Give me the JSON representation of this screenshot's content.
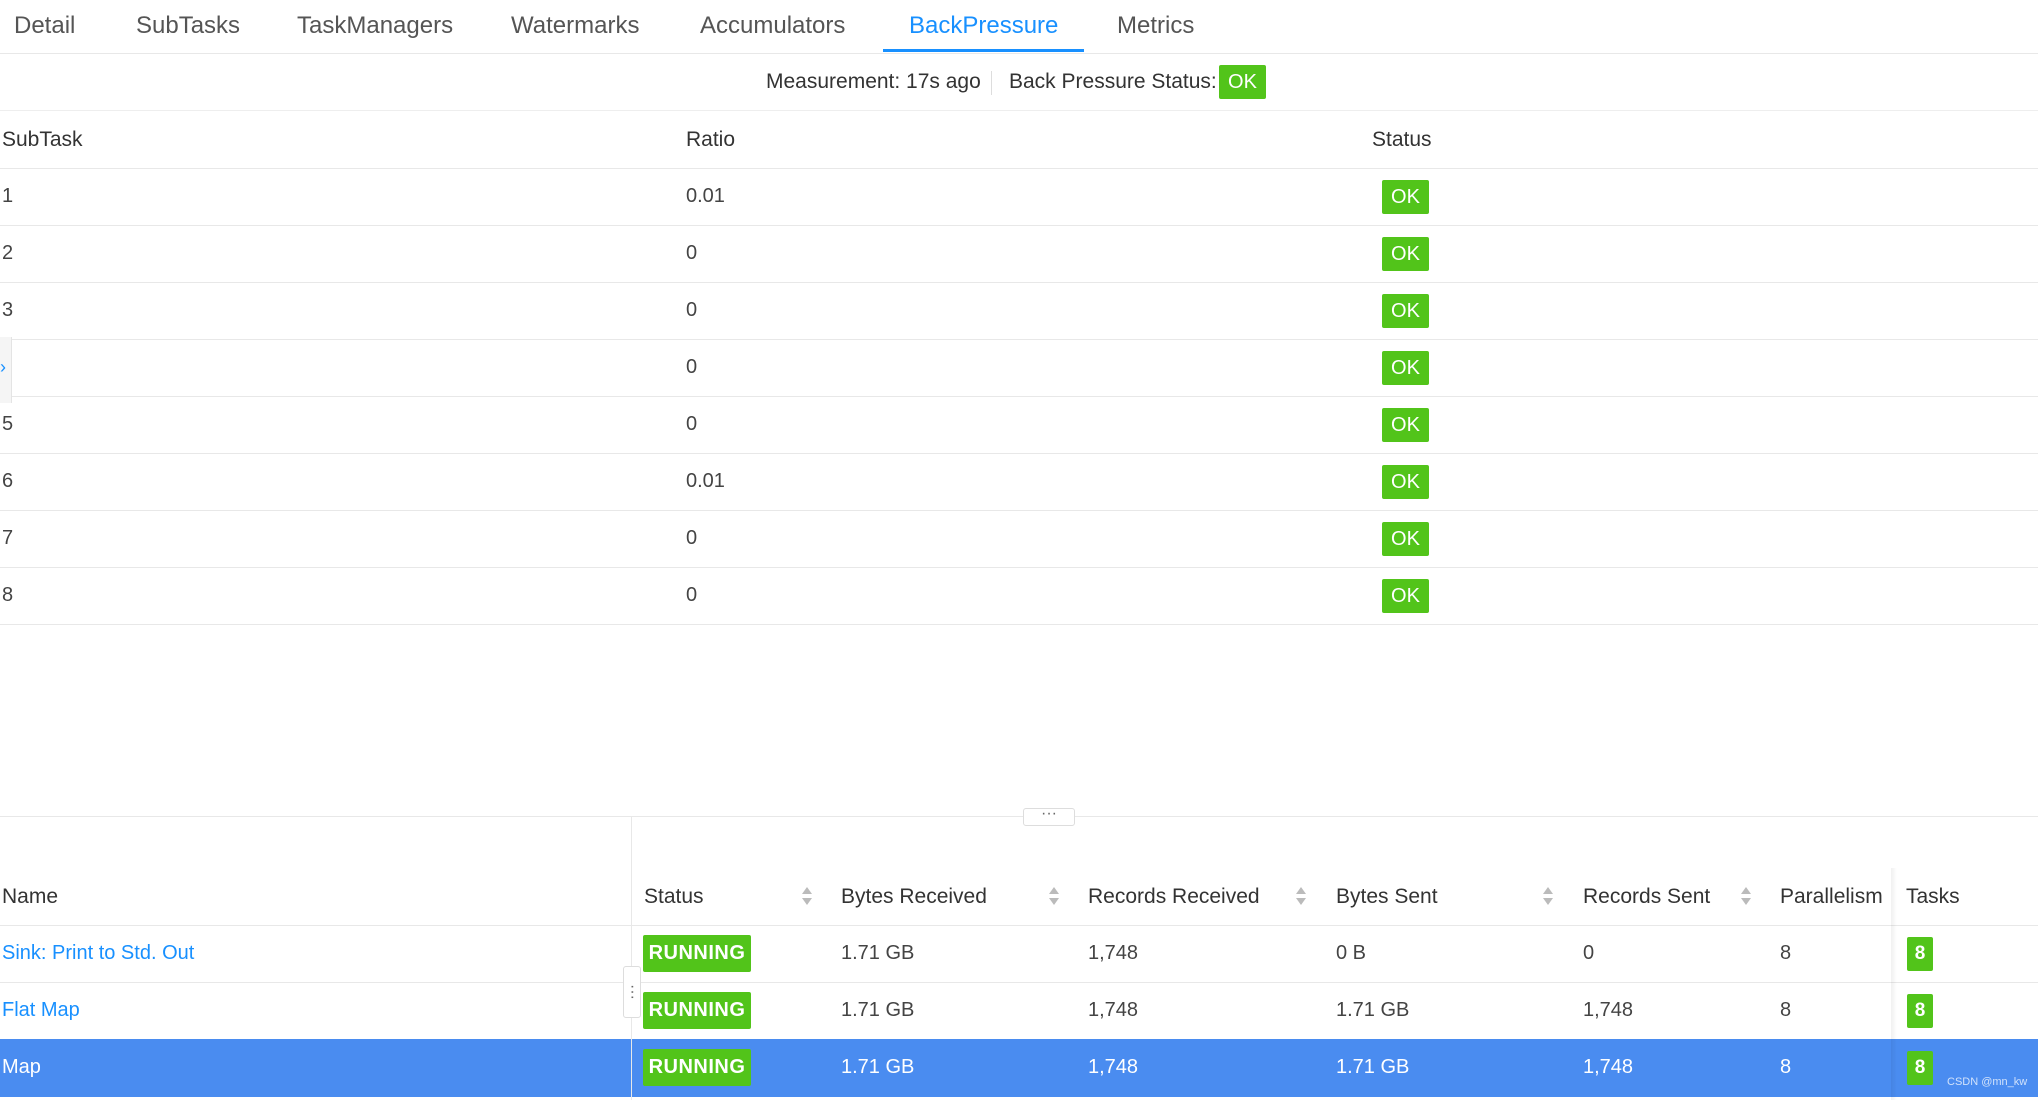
{
  "tabs": [
    "Detail",
    "SubTasks",
    "TaskManagers",
    "Watermarks",
    "Accumulators",
    "BackPressure",
    "Metrics"
  ],
  "active_tab": "BackPressure",
  "measurement": {
    "label": "Measurement: 17s ago",
    "status_label": "Back Pressure Status:",
    "status": "OK"
  },
  "backpressure_table": {
    "columns": [
      "SubTask",
      "Ratio",
      "Status"
    ],
    "rows": [
      {
        "subtask": "1",
        "ratio": "0.01",
        "status": "OK"
      },
      {
        "subtask": "2",
        "ratio": "0",
        "status": "OK"
      },
      {
        "subtask": "3",
        "ratio": "0",
        "status": "OK"
      },
      {
        "subtask": "",
        "ratio": "0",
        "status": "OK"
      },
      {
        "subtask": "5",
        "ratio": "0",
        "status": "OK"
      },
      {
        "subtask": "6",
        "ratio": "0.01",
        "status": "OK"
      },
      {
        "subtask": "7",
        "ratio": "0",
        "status": "OK"
      },
      {
        "subtask": "8",
        "ratio": "0",
        "status": "OK"
      }
    ]
  },
  "splitter_handle": "···",
  "vertex_table": {
    "columns": [
      "Name",
      "Status",
      "Bytes Received",
      "Records Received",
      "Bytes Sent",
      "Records Sent",
      "Parallelism",
      "Tasks"
    ],
    "rows": [
      {
        "name": "Sink: Print to Std. Out",
        "status": "RUNNING",
        "bytes_received": "1.71 GB",
        "records_received": "1,748",
        "bytes_sent": "0 B",
        "records_sent": "0",
        "parallelism": "8",
        "tasks": "8"
      },
      {
        "name": "Flat Map",
        "status": "RUNNING",
        "bytes_received": "1.71 GB",
        "records_received": "1,748",
        "bytes_sent": "1.71 GB",
        "records_sent": "1,748",
        "parallelism": "8",
        "tasks": "8"
      },
      {
        "name": "Map",
        "status": "RUNNING",
        "bytes_received": "1.71 GB",
        "records_received": "1,748",
        "bytes_sent": "1.71 GB",
        "records_sent": "1,748",
        "parallelism": "8",
        "tasks": "8"
      }
    ],
    "selected_row": "Map"
  },
  "watermark": "CSDN @mn_kw",
  "colors": {
    "accent": "#1890ff",
    "ok": "#52c41a",
    "selected_row": "#4a8cf0"
  }
}
